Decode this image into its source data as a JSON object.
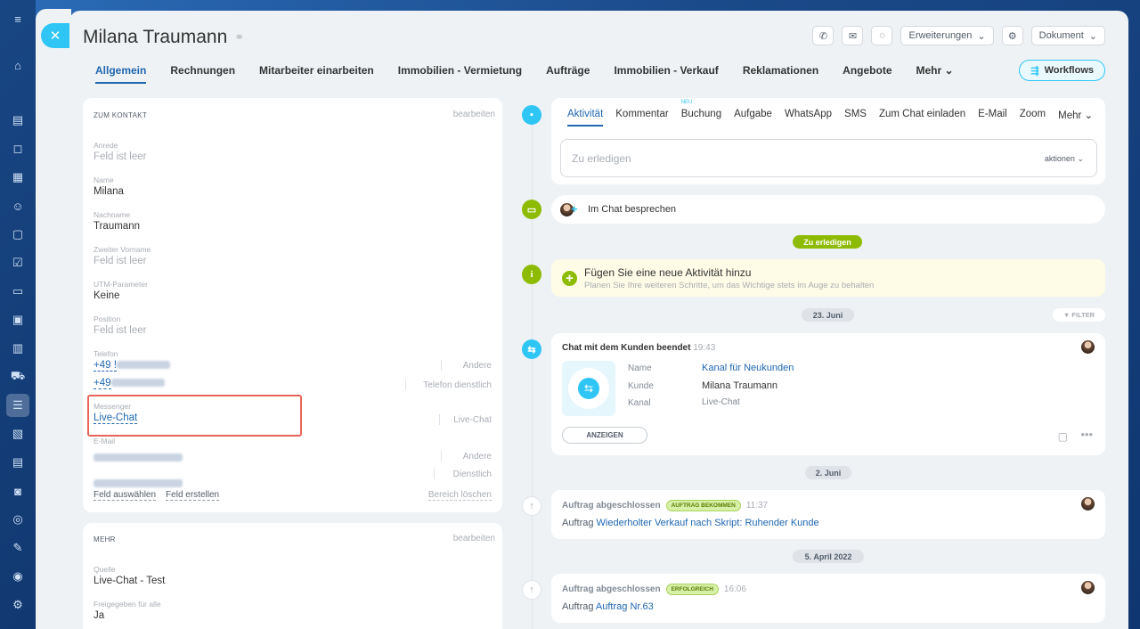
{
  "contact": {
    "name": "Milana Traumann"
  },
  "header_actions": {
    "extensions": "Erweiterungen",
    "document": "Dokument"
  },
  "tabs": [
    "Allgemein",
    "Rechnungen",
    "Mitarbeiter einarbeiten",
    "Immobilien - Vermietung",
    "Aufträge",
    "Immobilien - Verkauf",
    "Reklamationen",
    "Angebote",
    "Mehr"
  ],
  "workflows_label": "Workflows",
  "about": {
    "header": "ZUM KONTAKT",
    "edit": "bearbeiten",
    "fields": [
      {
        "label": "Anrede",
        "value": "Feld ist leer"
      },
      {
        "label": "Name",
        "value": "Milana"
      },
      {
        "label": "Nachname",
        "value": "Traumann"
      },
      {
        "label": "Zweiter Vorname",
        "value": "Feld ist leer"
      },
      {
        "label": "UTM-Parameter",
        "value": "Keine"
      },
      {
        "label": "Position",
        "value": "Feld ist leer"
      }
    ],
    "phone": {
      "label": "Telefon",
      "items": [
        {
          "value": "+49 !",
          "type": "Andere"
        },
        {
          "value": "+49",
          "type": "Telefon dienstlich"
        }
      ]
    },
    "messenger": {
      "label": "Messenger",
      "value": "Live-Chat",
      "type": "Live-Chat"
    },
    "email": {
      "label": "E-Mail",
      "types": [
        "Andere",
        "Dienstlich"
      ]
    },
    "select_field": "Feld auswählen",
    "create_field": "Feld erstellen",
    "clear_section": "Bereich löschen"
  },
  "more": {
    "header": "MEHR",
    "edit": "bearbeiten",
    "fields": [
      {
        "label": "Quelle",
        "value": "Live-Chat - Test"
      },
      {
        "label": "Freigegeben für alle",
        "value": "Ja"
      }
    ]
  },
  "activity": {
    "tabs": [
      "Aktivität",
      "Kommentar",
      "Buchung",
      "Aufgabe",
      "WhatsApp",
      "SMS",
      "Zum Chat einladen",
      "E-Mail",
      "Zoom",
      "Mehr"
    ],
    "new_badge": "NEU",
    "todo_placeholder": "Zu erledigen",
    "actions": "aktionen"
  },
  "chat_discuss": "Im Chat besprechen",
  "todo_pill": "Zu erledigen",
  "new_activity": {
    "title": "Fügen Sie eine neue Aktivität hinzu",
    "subtitle": "Planen Sie Ihre weiteren Schritte, um das Wichtige stets im Auge zu behalten"
  },
  "dates": [
    "23. Juni",
    "2. Juni",
    "5. April 2022"
  ],
  "filter": "FILTER",
  "chat_ended": {
    "title": "Chat mit dem Kunden beendet",
    "time": "19:43",
    "rows": [
      [
        "Name",
        "Kanal für Neukunden"
      ],
      [
        "Kunde",
        "Milana Traumann"
      ],
      [
        "Kanal",
        "Live-Chat"
      ]
    ],
    "button": "ANZEIGEN"
  },
  "orders": [
    {
      "title": "Auftrag abgeschlossen",
      "badge": "AUFTRAG BEKOMMEN",
      "time": "11:37",
      "prefix": "Auftrag",
      "link": "Wiederholter Verkauf nach Skript: Ruhender Kunde"
    },
    {
      "title": "Auftrag abgeschlossen",
      "badge": "ERFOLGREICH",
      "time": "16:06",
      "prefix": "Auftrag",
      "link": "Auftrag Nr.63"
    }
  ]
}
